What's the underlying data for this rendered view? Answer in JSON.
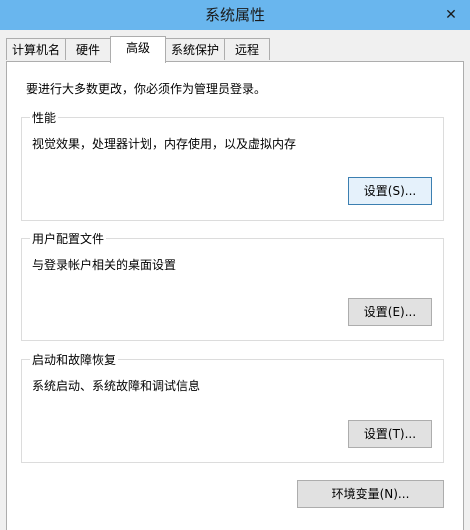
{
  "window": {
    "title": "系统属性",
    "close_glyph": "✕"
  },
  "tabs": [
    "计算机名",
    "硬件",
    "高级",
    "系统保护",
    "远程"
  ],
  "notice": "要进行大多数更改，你必须作为管理员登录。",
  "performance": {
    "title": "性能",
    "description": "视觉效果，处理器计划，内存使用，以及虚拟内存",
    "button": "设置(S)..."
  },
  "user_profiles": {
    "title": "用户配置文件",
    "description": "与登录帐户相关的桌面设置",
    "button": "设置(E)..."
  },
  "startup_recovery": {
    "title": "启动和故障恢复",
    "description": "系统启动、系统故障和调试信息",
    "button": "设置(T)..."
  },
  "env_button": "环境变量(N)..."
}
